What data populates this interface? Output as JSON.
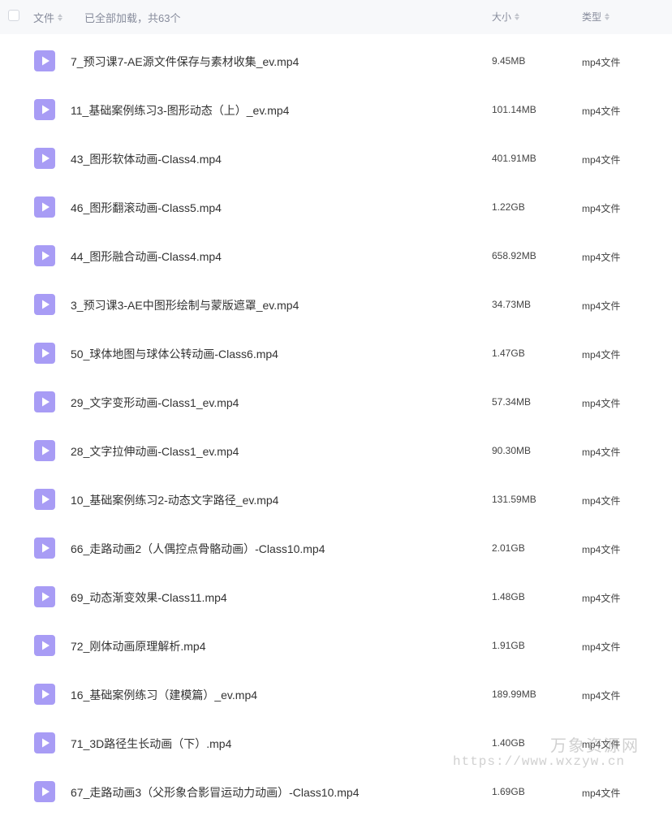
{
  "header": {
    "name_label": "文件",
    "status_text": "已全部加载，共63个",
    "size_label": "大小",
    "type_label": "类型"
  },
  "files": [
    {
      "name": "7_预习课7-AE源文件保存与素材收集_ev.mp4",
      "size": "9.45MB",
      "type": "mp4文件"
    },
    {
      "name": "11_基础案例练习3-图形动态（上）_ev.mp4",
      "size": "101.14MB",
      "type": "mp4文件"
    },
    {
      "name": "43_图形软体动画-Class4.mp4",
      "size": "401.91MB",
      "type": "mp4文件"
    },
    {
      "name": "46_图形翻滚动画-Class5.mp4",
      "size": "1.22GB",
      "type": "mp4文件"
    },
    {
      "name": "44_图形融合动画-Class4.mp4",
      "size": "658.92MB",
      "type": "mp4文件"
    },
    {
      "name": "3_预习课3-AE中图形绘制与蒙版遮罩_ev.mp4",
      "size": "34.73MB",
      "type": "mp4文件"
    },
    {
      "name": "50_球体地图与球体公转动画-Class6.mp4",
      "size": "1.47GB",
      "type": "mp4文件"
    },
    {
      "name": "29_文字变形动画-Class1_ev.mp4",
      "size": "57.34MB",
      "type": "mp4文件"
    },
    {
      "name": "28_文字拉伸动画-Class1_ev.mp4",
      "size": "90.30MB",
      "type": "mp4文件"
    },
    {
      "name": "10_基础案例练习2-动态文字路径_ev.mp4",
      "size": "131.59MB",
      "type": "mp4文件"
    },
    {
      "name": "66_走路动画2（人偶控点骨骼动画）-Class10.mp4",
      "size": "2.01GB",
      "type": "mp4文件"
    },
    {
      "name": "69_动态渐变效果-Class11.mp4",
      "size": "1.48GB",
      "type": "mp4文件"
    },
    {
      "name": "72_刚体动画原理解析.mp4",
      "size": "1.91GB",
      "type": "mp4文件"
    },
    {
      "name": "16_基础案例练习（建模篇）_ev.mp4",
      "size": "189.99MB",
      "type": "mp4文件"
    },
    {
      "name": "71_3D路径生长动画（下）.mp4",
      "size": "1.40GB",
      "type": "mp4文件"
    },
    {
      "name": "67_走路动画3（父形象合影冒运动力动画）-Class10.mp4",
      "size": "1.69GB",
      "type": "mp4文件"
    }
  ],
  "watermark": {
    "name": "万象资源网",
    "url": "https://www.wxzyw.cn"
  },
  "colors": {
    "icon": "#a89cf5",
    "header_bg": "#f7f8fa",
    "muted_text": "#878c9c"
  },
  "icons": {
    "file_icon": "video-file-icon",
    "sort_icon": "sort-arrows-icon"
  }
}
